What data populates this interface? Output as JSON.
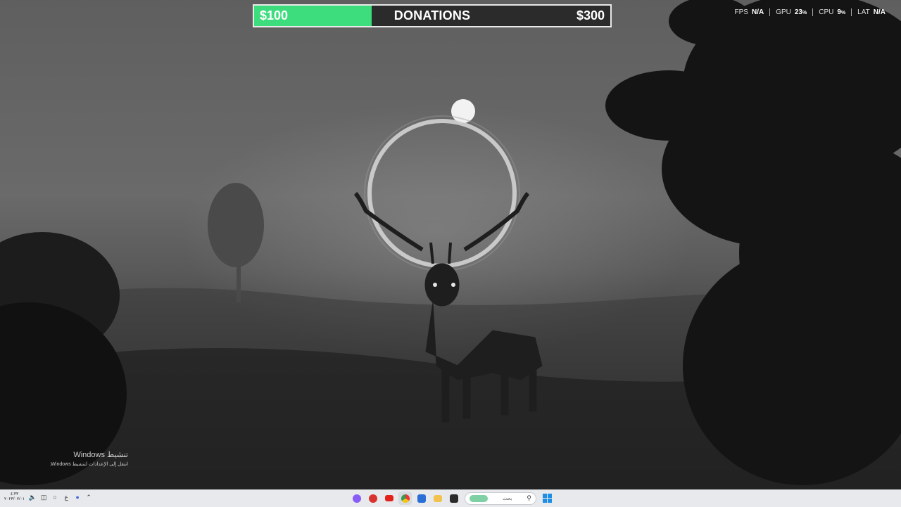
{
  "donation": {
    "current": "$100",
    "title": "DONATIONS",
    "goal": "$300",
    "progress": 0.33,
    "fill_color": "#3ddc7d"
  },
  "perf": {
    "fps_label": "FPS",
    "fps_value": "N/A",
    "gpu_label": "GPU",
    "gpu_value": "23",
    "gpu_unit": "%",
    "cpu_label": "CPU",
    "cpu_value": "9",
    "cpu_unit": "%",
    "lat_label": "LAT",
    "lat_value": "N/A"
  },
  "watermark": {
    "title": "تنشيط Windows",
    "subtitle": "انتقل إلى الإعدادات لتنشيط Windows."
  },
  "taskbar": {
    "time": "٤:٣٣",
    "date": "٢٠٢٣/٠٧/٠١",
    "language": "ع",
    "search_placeholder": "بحث",
    "apps": [
      {
        "name": "messenger-icon",
        "color": "#8a5cf6"
      },
      {
        "name": "app-icon",
        "color": "#d9332f"
      },
      {
        "name": "youtube-icon",
        "color": "#e3231b"
      },
      {
        "name": "chrome-icon",
        "color": "#2f9e52"
      },
      {
        "name": "store-icon",
        "color": "#2a6fd6"
      },
      {
        "name": "file-explorer-icon",
        "color": "#f2c14e"
      },
      {
        "name": "terminal-icon",
        "color": "#2b2b2b"
      }
    ]
  }
}
